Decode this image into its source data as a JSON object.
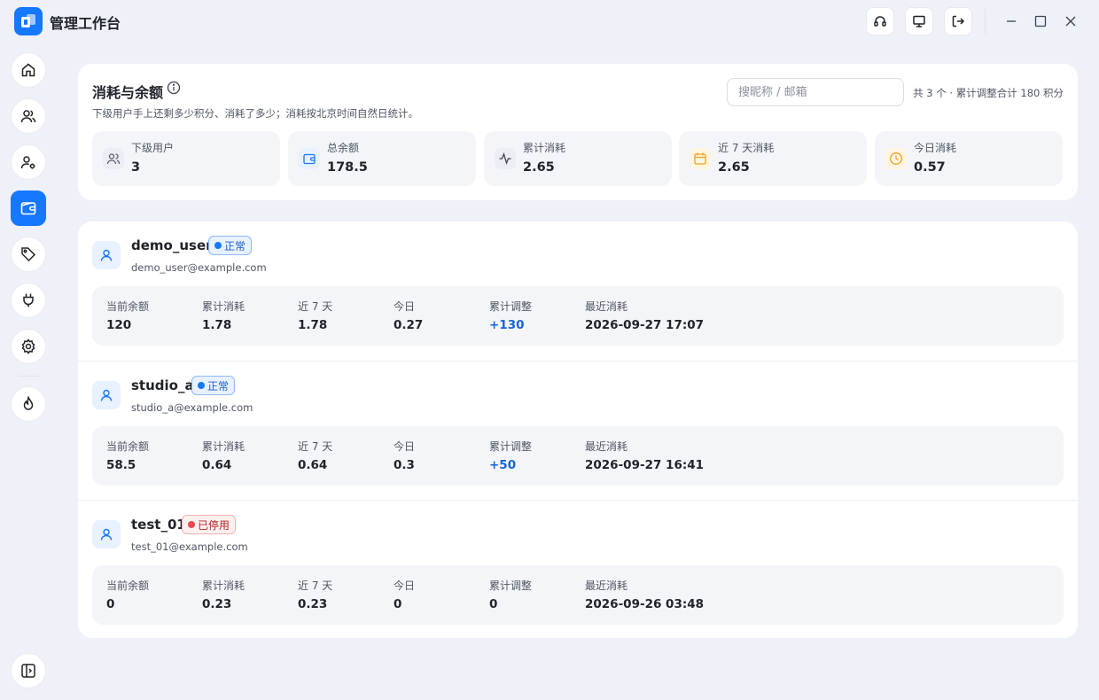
{
  "app": {
    "title": "管理工作台"
  },
  "summary": {
    "title": "消耗与余额",
    "subtitle": "下级用户手上还剩多少积分、消耗了多少；消耗按北京时间自然日统计。",
    "search_placeholder": "搜昵称 / 邮箱",
    "count_text": "共 3 个 · 累计调整合计 180 积分",
    "stats": [
      {
        "label": "下级用户",
        "value": "3",
        "icon": "users-icon",
        "color": "#5a6170"
      },
      {
        "label": "总余额",
        "value": "178.5",
        "icon": "wallet-icon",
        "color": "#1677ff"
      },
      {
        "label": "累计消耗",
        "value": "2.65",
        "icon": "activity-icon",
        "color": "#3b4252"
      },
      {
        "label": "近 7 天消耗",
        "value": "2.65",
        "icon": "calendar-icon",
        "color": "#f0a020"
      },
      {
        "label": "今日消耗",
        "value": "0.57",
        "icon": "clock-icon",
        "color": "#f0a020"
      }
    ]
  },
  "columns": [
    "当前余额",
    "累计消耗",
    "近 7 天",
    "今日",
    "累计调整",
    "最近消耗"
  ],
  "users": [
    {
      "name": "demo_user",
      "email": "demo_user@example.com",
      "status": "正常",
      "status_type": "ok",
      "balance": "120",
      "total": "1.78",
      "week": "1.78",
      "today": "0.27",
      "adjust": "+130",
      "last": "2026-09-27 17:07"
    },
    {
      "name": "studio_a",
      "email": "studio_a@example.com",
      "status": "正常",
      "status_type": "ok",
      "balance": "58.5",
      "total": "0.64",
      "week": "0.64",
      "today": "0.3",
      "adjust": "+50",
      "last": "2026-09-27 16:41"
    },
    {
      "name": "test_01",
      "email": "test_01@example.com",
      "status": "已停用",
      "status_type": "off",
      "balance": "0",
      "total": "0.23",
      "week": "0.23",
      "today": "0",
      "adjust": "0",
      "last": "2026-09-26 03:48"
    }
  ],
  "colors": {
    "accent": "#1677ff",
    "background": "#eef1f8",
    "positive": "#1664d8",
    "disabled": "#f0484c"
  }
}
